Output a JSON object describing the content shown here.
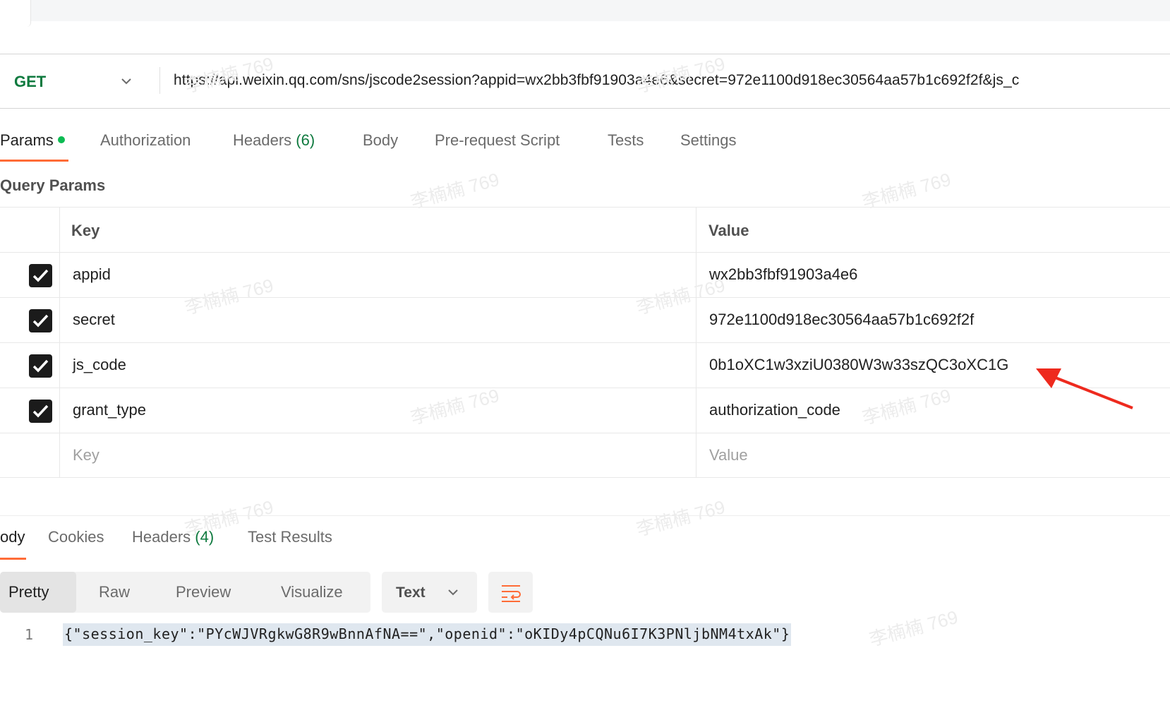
{
  "request": {
    "method": "GET",
    "url": "https://api.weixin.qq.com/sns/jscode2session?appid=wx2bb3fbf91903a4e6&secret=972e1100d918ec30564aa57b1c692f2f&js_c"
  },
  "request_tabs": {
    "params": "Params",
    "authorization": "Authorization",
    "headers_label": "Headers",
    "headers_count": "(6)",
    "body": "Body",
    "pre_request": "Pre-request Script",
    "tests": "Tests",
    "settings": "Settings"
  },
  "query_params": {
    "title": "Query Params",
    "columns": {
      "key": "Key",
      "value": "Value"
    },
    "rows": [
      {
        "key": "appid",
        "value": "wx2bb3fbf91903a4e6",
        "checked": true
      },
      {
        "key": "secret",
        "value": "972e1100d918ec30564aa57b1c692f2f",
        "checked": true
      },
      {
        "key": "js_code",
        "value": "0b1oXC1w3xziU0380W3w33szQC3oXC1G",
        "checked": true
      },
      {
        "key": "grant_type",
        "value": "authorization_code",
        "checked": true
      }
    ],
    "placeholder": {
      "key": "Key",
      "value": "Value"
    }
  },
  "response_tabs": {
    "body": "ody",
    "cookies": "Cookies",
    "headers_label": "Headers",
    "headers_count": "(4)",
    "test_results": "Test Results"
  },
  "response_view": {
    "modes": [
      "Pretty",
      "Raw",
      "Preview",
      "Visualize"
    ],
    "format": "Text"
  },
  "response_body": {
    "line_number": "1",
    "line": "{\"session_key\":\"PYcWJVRgkwG8R9wBnnAfNA==\",\"openid\":\"oKIDy4pCQNu6I7K3PNljbNM4txAk\"}"
  },
  "watermark": "李楠楠 769",
  "colors": {
    "accent": "#ff6c37",
    "method_get": "#0f7a3f",
    "status_dot": "#0cbb52"
  }
}
